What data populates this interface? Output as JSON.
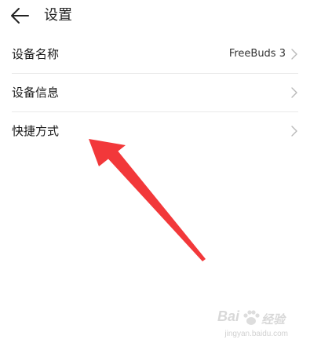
{
  "header": {
    "title": "设置",
    "back_icon": "arrow-left-icon"
  },
  "settings": {
    "items": [
      {
        "label": "设备名称",
        "value": "FreeBuds 3",
        "icon": "chevron-right-icon"
      },
      {
        "label": "设备信息",
        "value": "",
        "icon": "chevron-right-icon"
      },
      {
        "label": "快捷方式",
        "value": "",
        "icon": "chevron-right-icon"
      }
    ]
  },
  "annotation": {
    "arrow_color": "#f2383a",
    "target": "快捷方式"
  },
  "watermark": {
    "brand": "Bai",
    "brand_suffix": "经验",
    "url": "jingyan.baidu.com"
  },
  "colors": {
    "divider": "#e9e9e9",
    "chevron": "#b8b8b8",
    "text": "#1a1a1a"
  }
}
